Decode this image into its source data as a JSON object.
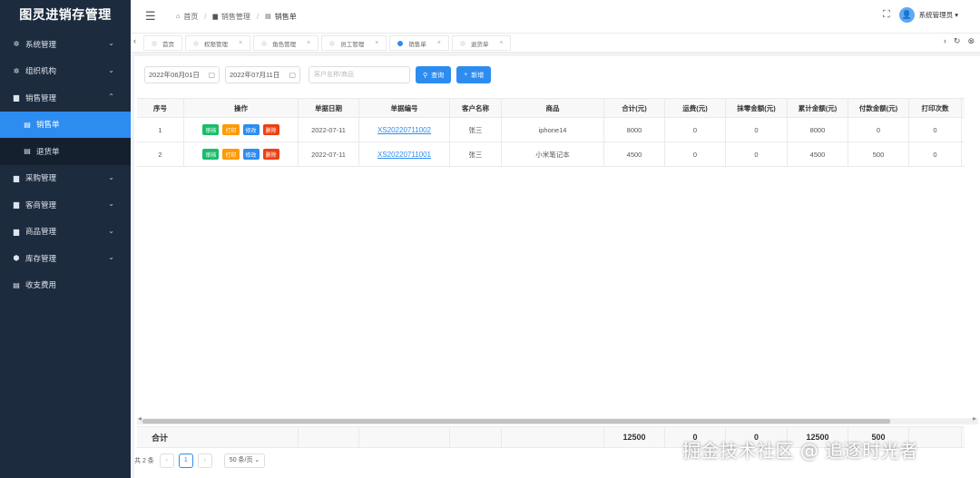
{
  "app": {
    "title": "图灵进销存管理"
  },
  "sidebar": {
    "items": [
      {
        "label": "系统管理",
        "icon": "gear-icon",
        "glyph": "✲",
        "chevron": "⌄"
      },
      {
        "label": "组织机构",
        "icon": "gear-icon",
        "glyph": "✲",
        "chevron": "⌄"
      },
      {
        "label": "销售管理",
        "icon": "folder-icon",
        "glyph": "▆",
        "chevron": "⌃",
        "expanded": true,
        "children": [
          {
            "label": "销售单",
            "icon": "list-icon",
            "glyph": "▤",
            "active": true
          },
          {
            "label": "退货单",
            "icon": "list-icon",
            "glyph": "▤"
          }
        ]
      },
      {
        "label": "采购管理",
        "icon": "folder-icon",
        "glyph": "▆",
        "chevron": "⌄"
      },
      {
        "label": "客商管理",
        "icon": "folder-icon",
        "glyph": "▆",
        "chevron": "⌄"
      },
      {
        "label": "商品管理",
        "icon": "folder-icon",
        "glyph": "▆",
        "chevron": "⌄"
      },
      {
        "label": "库存管理",
        "icon": "cube-icon",
        "glyph": "⬢",
        "chevron": "⌄"
      },
      {
        "label": "收支费用",
        "icon": "list-icon",
        "glyph": "▤"
      }
    ]
  },
  "header": {
    "menu_glyph": "☰",
    "breadcrumb": [
      {
        "label": "首页",
        "icon": "home-icon",
        "glyph": "⌂"
      },
      {
        "label": "销售管理",
        "icon": "folder-icon",
        "glyph": "▆"
      },
      {
        "label": "销售单",
        "icon": "list-icon",
        "glyph": "▤"
      }
    ],
    "separator": "/",
    "fullscreen_glyph": "⛶",
    "avatar_glyph": "👤",
    "user_name": "系统管理员 ▾"
  },
  "tabs": {
    "left_glyph": "‹",
    "right_glyphs": {
      "next": "›",
      "refresh": "↻",
      "close_all": "⊗"
    },
    "items": [
      {
        "label": "首页",
        "closable": false
      },
      {
        "label": "权限管理",
        "closable": true
      },
      {
        "label": "角色管理",
        "closable": true
      },
      {
        "label": "员工管理",
        "closable": true
      },
      {
        "label": "销售单",
        "closable": true,
        "active": true
      },
      {
        "label": "退货单",
        "closable": true
      }
    ],
    "close_glyph": "×"
  },
  "toolbar": {
    "start_date": "2022年06月01日",
    "end_date": "2022年07月11日",
    "calendar_glyph": "▢",
    "search_placeholder": "客户名称/商品",
    "query_label": "查询",
    "query_glyph": "⚲",
    "add_label": "新增",
    "add_glyph": "+"
  },
  "table": {
    "columns": [
      "序号",
      "操作",
      "单据日期",
      "单据编号",
      "客户名称",
      "商品",
      "合计(元)",
      "运费(元)",
      "抹零金额(元)",
      "累计金额(元)",
      "付款金额(元)",
      "打印次数"
    ],
    "actions": [
      "审核",
      "打印",
      "修改",
      "删除"
    ],
    "rows": [
      {
        "index": "1",
        "date": "2022-07-11",
        "code": "XS20220711002",
        "customer": "张三",
        "product": "iphone14",
        "total": "8000",
        "freight": "0",
        "rounding": "0",
        "accumulated": "8000",
        "paid": "0",
        "prints": "0"
      },
      {
        "index": "2",
        "date": "2022-07-11",
        "code": "XS20220711001",
        "customer": "张三",
        "product": "小米笔记本",
        "total": "4500",
        "freight": "0",
        "rounding": "0",
        "accumulated": "4500",
        "paid": "500",
        "prints": "0"
      }
    ],
    "summary": {
      "label": "合计",
      "total": "12500",
      "freight": "0",
      "rounding": "0",
      "accumulated": "12500",
      "paid": "500"
    }
  },
  "pagination": {
    "total_text": "共 2 条",
    "prev_glyph": "‹",
    "next_glyph": "›",
    "current_page": "1",
    "page_size": "50 条/页 ⌄"
  },
  "watermark": "掘金技术社区 @ 追逐时光者"
}
